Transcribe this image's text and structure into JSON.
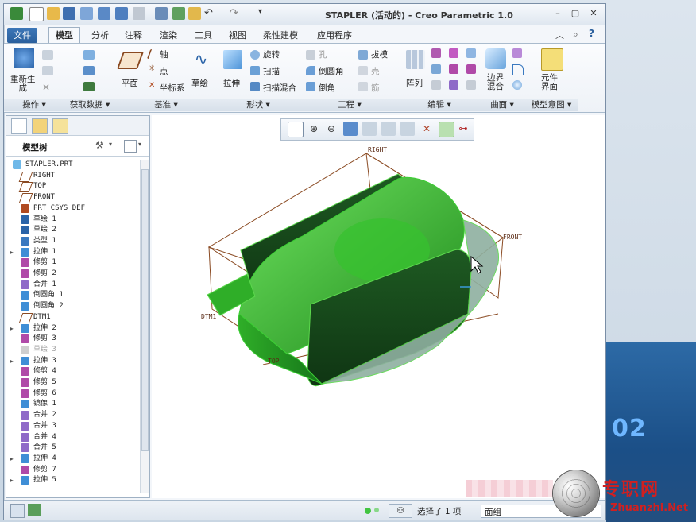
{
  "window": {
    "title": "STAPLER (活动的) - Creo Parametric 1.0",
    "controls": {
      "minimize": "–",
      "restore": "▢",
      "close": "✕"
    }
  },
  "tabs": [
    "文件",
    "模型",
    "分析",
    "注释",
    "渲染",
    "工具",
    "视图",
    "柔性建模",
    "应用程序"
  ],
  "active_tab": "模型",
  "ribbon": {
    "regenerate": "重新生\n成",
    "plane": "平面",
    "axis": "轴",
    "point": "点",
    "csys": "坐标系",
    "sketch": "草绘",
    "extrude": "拉伸",
    "revolve": "旋转",
    "sweep": "扫描",
    "swept_blend": "扫描混合",
    "hole": "孔",
    "round": "倒圆角",
    "chamfer": "倒角",
    "draft": "拔模",
    "shell": "壳",
    "rib": "筋",
    "pattern": "阵列",
    "boundary_blend": "边界\n混合",
    "component_interface": "元件\n界面",
    "groups": [
      "操作",
      "获取数据",
      "基准",
      "形状",
      "工程",
      "编辑",
      "曲面",
      "模型意图"
    ]
  },
  "model_tree": {
    "title": "模型树",
    "items": [
      {
        "label": "STAPLER.PRT",
        "level": 0,
        "expand": "",
        "kind": "part",
        "dim": false
      },
      {
        "label": "RIGHT",
        "level": 1,
        "expand": "",
        "kind": "plane",
        "dim": false
      },
      {
        "label": "TOP",
        "level": 1,
        "expand": "",
        "kind": "plane",
        "dim": false
      },
      {
        "label": "FRONT",
        "level": 1,
        "expand": "",
        "kind": "plane",
        "dim": false
      },
      {
        "label": "PRT_CSYS_DEF",
        "level": 1,
        "expand": "",
        "kind": "csys",
        "dim": false
      },
      {
        "label": "草绘 1",
        "level": 1,
        "expand": "",
        "kind": "sketch",
        "dim": false
      },
      {
        "label": "草绘 2",
        "level": 1,
        "expand": "",
        "kind": "sketch",
        "dim": false
      },
      {
        "label": "类型 1",
        "level": 1,
        "expand": "",
        "kind": "style",
        "dim": false
      },
      {
        "label": "拉伸 1",
        "level": 1,
        "expand": "▶",
        "kind": "extrude",
        "dim": false
      },
      {
        "label": "修剪 1",
        "level": 1,
        "expand": "",
        "kind": "trim",
        "dim": false
      },
      {
        "label": "修剪 2",
        "level": 1,
        "expand": "",
        "kind": "trim",
        "dim": false
      },
      {
        "label": "合并 1",
        "level": 1,
        "expand": "",
        "kind": "merge",
        "dim": false
      },
      {
        "label": "倒圆角 1",
        "level": 1,
        "expand": "",
        "kind": "round",
        "dim": false
      },
      {
        "label": "倒圆角 2",
        "level": 1,
        "expand": "",
        "kind": "round",
        "dim": false
      },
      {
        "label": "DTM1",
        "level": 1,
        "expand": "",
        "kind": "plane",
        "dim": false
      },
      {
        "label": "拉伸 2",
        "level": 1,
        "expand": "▶",
        "kind": "extrude",
        "dim": false
      },
      {
        "label": "修剪 3",
        "level": 1,
        "expand": "",
        "kind": "trim",
        "dim": false
      },
      {
        "label": "草绘 3",
        "level": 1,
        "expand": "",
        "kind": "sketch",
        "dim": true
      },
      {
        "label": "拉伸 3",
        "level": 1,
        "expand": "▶",
        "kind": "extrude",
        "dim": false
      },
      {
        "label": "修剪 4",
        "level": 1,
        "expand": "",
        "kind": "trim",
        "dim": false
      },
      {
        "label": "修剪 5",
        "level": 1,
        "expand": "",
        "kind": "trim",
        "dim": false
      },
      {
        "label": "修剪 6",
        "level": 1,
        "expand": "",
        "kind": "trim",
        "dim": false
      },
      {
        "label": "镜像 1",
        "level": 1,
        "expand": "",
        "kind": "mirror",
        "dim": false
      },
      {
        "label": "合并 2",
        "level": 1,
        "expand": "",
        "kind": "merge",
        "dim": false
      },
      {
        "label": "合并 3",
        "level": 1,
        "expand": "",
        "kind": "merge",
        "dim": false
      },
      {
        "label": "合并 4",
        "level": 1,
        "expand": "",
        "kind": "merge",
        "dim": false
      },
      {
        "label": "合并 5",
        "level": 1,
        "expand": "",
        "kind": "merge",
        "dim": false
      },
      {
        "label": "拉伸 4",
        "level": 1,
        "expand": "▶",
        "kind": "extrude",
        "dim": false
      },
      {
        "label": "修剪 7",
        "level": 1,
        "expand": "",
        "kind": "trim",
        "dim": false
      },
      {
        "label": "拉伸 5",
        "level": 1,
        "expand": "▶",
        "kind": "extrude",
        "dim": false
      }
    ]
  },
  "canvas_labels": {
    "right": "RIGHT",
    "front": "FRONT",
    "dtm1": "DTM1",
    "top": "TOP"
  },
  "status": {
    "selected": "选择了 1 项",
    "filter": "面组"
  },
  "watermark": {
    "brand": "专职网",
    "url": "Zhuanzhi.Net",
    "bg_number": "02"
  },
  "colors": {
    "model_green": "#2fae28",
    "datum_brown": "#8a4a22",
    "accent_blue": "#2a5f9d"
  }
}
